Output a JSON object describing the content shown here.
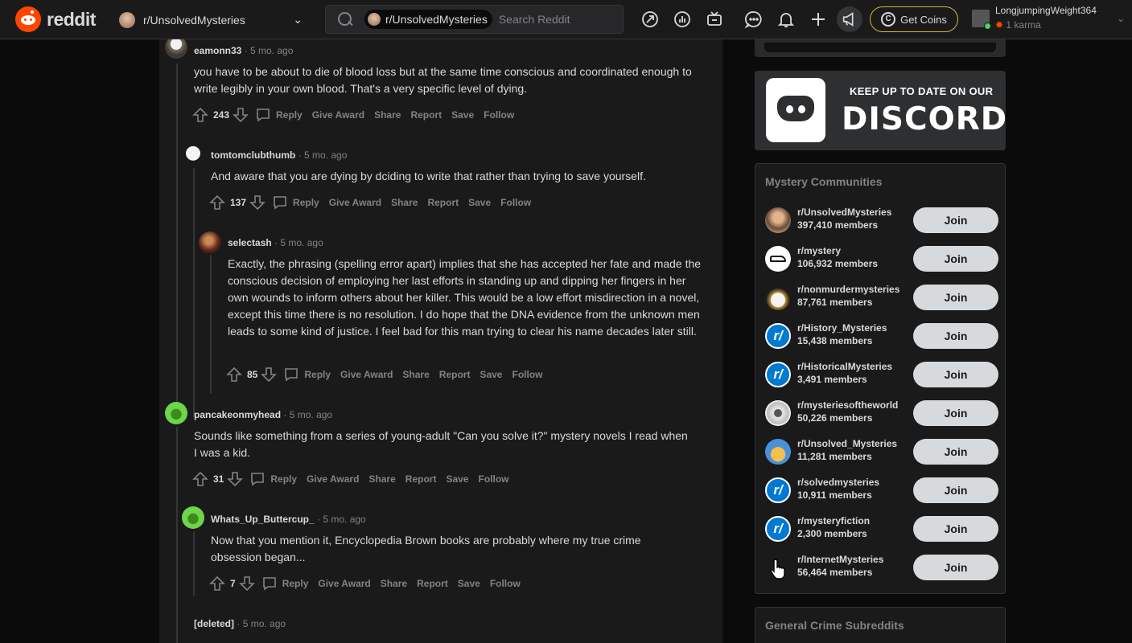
{
  "header": {
    "logo_text": "reddit",
    "community": "r/UnsolvedMysteries",
    "search_chip": "r/UnsolvedMysteries",
    "search_placeholder": "Search Reddit",
    "get_coins": "Get Coins",
    "username": "LongjumpingWeight364",
    "karma": "1 karma",
    "icons": [
      "popular-icon",
      "stats-icon",
      "live-icon",
      "chat-icon",
      "notification-icon",
      "create-icon",
      "advertise-icon"
    ]
  },
  "comments": [
    {
      "user": "eamonn33",
      "time": "5 mo. ago",
      "body": "you have to be about to die of blood loss but at the same time conscious and coordinated enough to write legibly in your own blood. That's a very specific level of dying.",
      "score": "243"
    },
    {
      "user": "tomtomclubthumb",
      "time": "5 mo. ago",
      "body": "And aware that you are dying by dciding to write that rather than trying to save yourself.",
      "score": "137"
    },
    {
      "user": "selectash",
      "time": "5 mo. ago",
      "body": "Exactly, the phrasing (spelling error apart) implies that she has accepted her fate and made the conscious decision of employing her last efforts in standing up and dipping her fingers in her own wounds to inform others about her killer. This would be a low effort misdirection in a novel, except this time there is no resolution. I do hope that the DNA evidence from the unknown men leads to some kind of justice. I feel bad for this man trying to clear his name decades later still.",
      "score": "85"
    },
    {
      "user": "pancakeonmyhead",
      "time": "5 mo. ago",
      "body": "Sounds like something from a series of young-adult \"Can you solve it?\" mystery novels I read when I was a kid.",
      "score": "31"
    },
    {
      "user": "Whats_Up_Buttercup_",
      "time": "5 mo. ago",
      "body": "Now that you mention it, Encyclopedia Brown books are probably where my true crime obsession began...",
      "score": "7"
    },
    {
      "user": "[deleted]",
      "time": "5 mo. ago",
      "body": "",
      "score": ""
    }
  ],
  "actions": {
    "reply": "Reply",
    "give_award": "Give Award",
    "share": "Share",
    "report": "Report",
    "save": "Save",
    "follow": "Follow"
  },
  "sidebar": {
    "discord_line1": "KEEP UP TO DATE ON OUR",
    "discord_line2": "DISCORD",
    "mystery_title": "Mystery Communities",
    "communities": [
      {
        "name": "r/UnsolvedMysteries",
        "members": "397,410 members",
        "join": "Join"
      },
      {
        "name": "r/mystery",
        "members": "106,932 members",
        "join": "Join"
      },
      {
        "name": "r/nonmurdermysteries",
        "members": "87,761 members",
        "join": "Join"
      },
      {
        "name": "r/History_Mysteries",
        "members": "15,438 members",
        "join": "Join"
      },
      {
        "name": "r/HistoricalMysteries",
        "members": "3,491 members",
        "join": "Join"
      },
      {
        "name": "r/mysteriesoftheworld",
        "members": "50,226 members",
        "join": "Join"
      },
      {
        "name": "r/Unsolved_Mysteries",
        "members": "11,281 members",
        "join": "Join"
      },
      {
        "name": "r/solvedmysteries",
        "members": "10,911 members",
        "join": "Join"
      },
      {
        "name": "r/mysteryfiction",
        "members": "2,300 members",
        "join": "Join"
      },
      {
        "name": "r/InternetMysteries",
        "members": "56,464 members",
        "join": "Join"
      }
    ],
    "crime_title": "General Crime Subreddits"
  },
  "colors": {
    "accent": "#ff4500",
    "coins_border": "#d7b43a",
    "join_bg": "#d7dadc",
    "online": "#46d160"
  }
}
